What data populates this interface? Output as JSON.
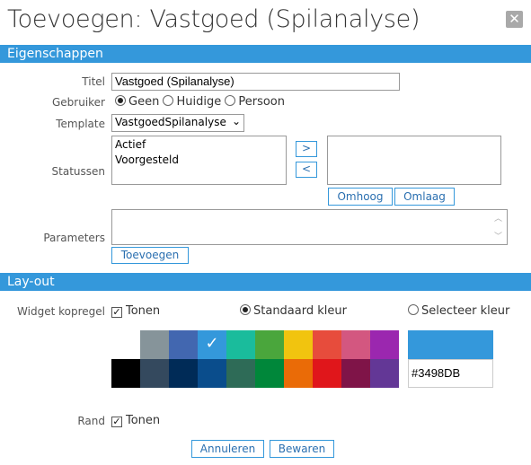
{
  "dialog": {
    "title": "Toevoegen: Vastgoed (Spilanalyse)",
    "close_icon": "close-icon"
  },
  "eigenschappen": {
    "header": "Eigenschappen",
    "titel_label": "Titel",
    "titel_value": "Vastgoed (Spilanalyse)",
    "gebruiker_label": "Gebruiker",
    "gebruiker_options": [
      "Geen",
      "Huidige",
      "Persoon"
    ],
    "gebruiker_selected": "Geen",
    "template_label": "Template",
    "template_value": "VastgoedSpilanalyse",
    "statussen_label": "Statussen",
    "statussen_left": [
      "Actief",
      "Voorgesteld"
    ],
    "statussen_right": [],
    "move_right": ">",
    "move_left": "<",
    "omhoog": "Omhoog",
    "omlaag": "Omlaag",
    "parameters_label": "Parameters",
    "parameters_value": "",
    "toevoegen": "Toevoegen"
  },
  "layout": {
    "header": "Lay-out",
    "widget_label": "Widget kopregel",
    "tonen": "Tonen",
    "tonen_checked": true,
    "standaard_kleur": "Standaard kleur",
    "selecteer_kleur": "Selecteer kleur",
    "selected_color_mode": "Standaard kleur",
    "palette": [
      [
        "#FFFFFF",
        "#86949A",
        "#4267B0",
        "#3498DB",
        "#1ABC9C",
        "#4AA63C",
        "#F1C40F",
        "#E74C3C",
        "#D35780",
        "#9B27AF"
      ],
      [
        "#000000",
        "#34495E",
        "#002B57",
        "#0A4D8C",
        "#2E6B57",
        "#00873A",
        "#EA6B07",
        "#E0161B",
        "#7F1448",
        "#633796"
      ]
    ],
    "selected_color": "#3498DB",
    "color_input": "#3498DB",
    "rand_label": "Rand",
    "rand_tonen": "Tonen",
    "rand_checked": true
  },
  "footer": {
    "annuleren": "Annuleren",
    "bewaren": "Bewaren"
  }
}
